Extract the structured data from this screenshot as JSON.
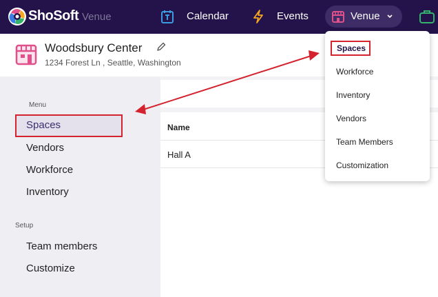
{
  "brand": {
    "name": "ShoSoft",
    "sub": "Venue"
  },
  "topnav": {
    "calendar_label": "Calendar",
    "events_label": "Events",
    "venue_label": "Venue"
  },
  "venue": {
    "name": "Woodsbury Center",
    "address": "1234 Forest Ln , Seattle, Washington"
  },
  "sidebar": {
    "menu_title": "Menu",
    "menu_items": [
      {
        "label": "Spaces",
        "active": true
      },
      {
        "label": "Vendors"
      },
      {
        "label": "Workforce"
      },
      {
        "label": "Inventory"
      }
    ],
    "setup_title": "Setup",
    "setup_items": [
      {
        "label": "Team members"
      },
      {
        "label": "Customize"
      }
    ]
  },
  "table": {
    "header_name": "Name",
    "rows": [
      {
        "name": "Hall A"
      }
    ]
  },
  "venue_dropdown": {
    "items": [
      {
        "label": "Spaces",
        "active": true
      },
      {
        "label": "Workforce"
      },
      {
        "label": "Inventory"
      },
      {
        "label": "Vendors"
      },
      {
        "label": "Team Members"
      },
      {
        "label": "Customization"
      }
    ]
  },
  "colors": {
    "topbar": "#24134a",
    "highlight_box": "#d4232f",
    "venue_pink": "#e0508a",
    "nav_icon": "#f5a623"
  }
}
